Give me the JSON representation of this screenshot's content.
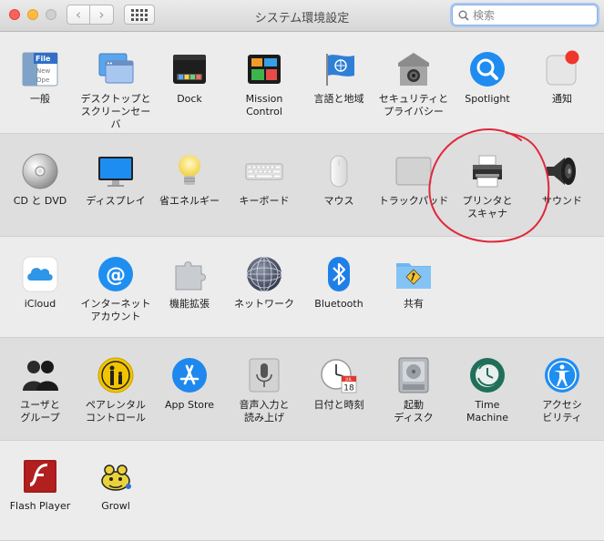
{
  "window": {
    "title": "システム環境設定"
  },
  "toolbar": {
    "back_glyph": "‹",
    "forward_glyph": "›"
  },
  "search": {
    "placeholder": "検索"
  },
  "colors": {
    "annotation": "#e0283c",
    "section_alt": "#dedede",
    "section_base": "#ececec"
  },
  "rows": [
    {
      "items": [
        {
          "label": "一般",
          "icon": "general-icon"
        },
        {
          "label": "デスクトップと\nスクリーンセーバ",
          "icon": "desktop-screensaver-icon"
        },
        {
          "label": "Dock",
          "icon": "dock-icon"
        },
        {
          "label": "Mission\nControl",
          "icon": "mission-control-icon"
        },
        {
          "label": "言語と地域",
          "icon": "language-region-icon"
        },
        {
          "label": "セキュリティと\nプライバシー",
          "icon": "security-icon"
        },
        {
          "label": "Spotlight",
          "icon": "spotlight-icon"
        },
        {
          "label": "通知",
          "icon": "notifications-icon"
        }
      ]
    },
    {
      "items": [
        {
          "label": "CD と DVD",
          "icon": "cd-dvd-icon"
        },
        {
          "label": "ディスプレイ",
          "icon": "display-icon"
        },
        {
          "label": "省エネルギー",
          "icon": "energy-saver-icon"
        },
        {
          "label": "キーボード",
          "icon": "keyboard-icon"
        },
        {
          "label": "マウス",
          "icon": "mouse-icon"
        },
        {
          "label": "トラックパッド",
          "icon": "trackpad-icon"
        },
        {
          "label": "プリンタと\nスキャナ",
          "icon": "printer-icon"
        },
        {
          "label": "サウンド",
          "icon": "sound-icon"
        }
      ]
    },
    {
      "items": [
        {
          "label": "iCloud",
          "icon": "icloud-icon"
        },
        {
          "label": "インターネット\nアカウント",
          "icon": "internet-accounts-icon"
        },
        {
          "label": "機能拡張",
          "icon": "extensions-icon"
        },
        {
          "label": "ネットワーク",
          "icon": "network-icon"
        },
        {
          "label": "Bluetooth",
          "icon": "bluetooth-icon"
        },
        {
          "label": "共有",
          "icon": "sharing-icon"
        }
      ]
    },
    {
      "items": [
        {
          "label": "ユーザと\nグループ",
          "icon": "users-groups-icon"
        },
        {
          "label": "ペアレンタル\nコントロール",
          "icon": "parental-controls-icon"
        },
        {
          "label": "App Store",
          "icon": "app-store-icon"
        },
        {
          "label": "音声入力と\n読み上げ",
          "icon": "dictation-speech-icon"
        },
        {
          "label": "日付と時刻",
          "icon": "date-time-icon"
        },
        {
          "label": "起動\nディスク",
          "icon": "startup-disk-icon"
        },
        {
          "label": "Time\nMachine",
          "icon": "time-machine-icon"
        },
        {
          "label": "アクセシ\nビリティ",
          "icon": "accessibility-icon"
        }
      ]
    },
    {
      "items": [
        {
          "label": "Flash Player",
          "icon": "flash-player-icon"
        },
        {
          "label": "Growl",
          "icon": "growl-icon"
        }
      ]
    }
  ],
  "icon_text": {
    "general": [
      "File",
      "New",
      "Ope"
    ],
    "calendar_month": "JUL",
    "calendar_day": "18"
  }
}
